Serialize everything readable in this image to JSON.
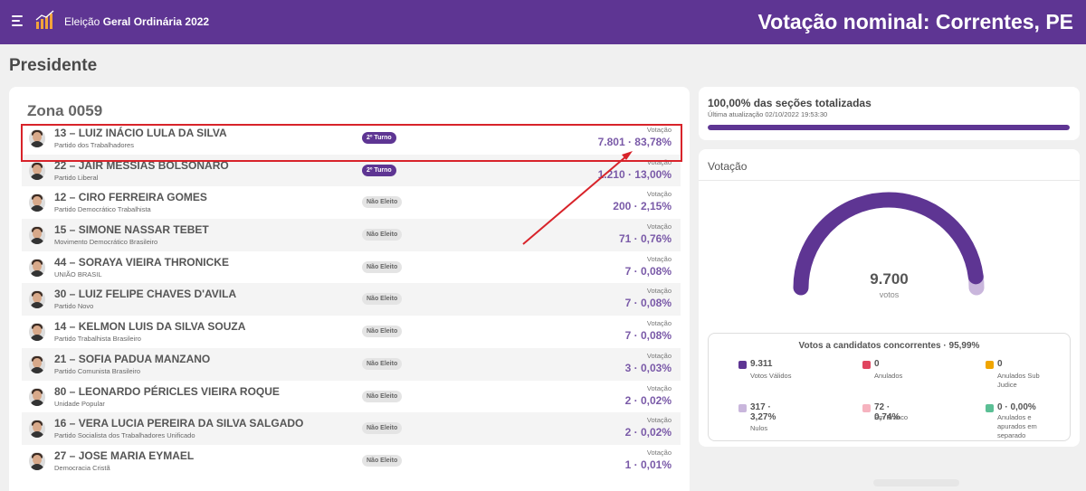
{
  "header": {
    "menu_icon": "hamburger-icon",
    "logo_icon": "bar-chart-icon",
    "app_title_prefix": "Eleição",
    "app_title_bold": "Geral Ordinária 2022",
    "page_title": "Votação nominal: Correntes, PE",
    "color": "#5e3593"
  },
  "section": {
    "title": "Presidente"
  },
  "zona": {
    "title": "Zona 0059"
  },
  "candidates": [
    {
      "name": "13 – LUIZ INÁCIO LULA DA SILVA",
      "party": "Partido dos Trabalhadores",
      "status": "2º Turno",
      "vote_label": "Votação",
      "vote": "7.801 · 83,78%"
    },
    {
      "name": "22 – JAIR MESSIAS BOLSONARO",
      "party": "Partido Liberal",
      "status": "2º Turno",
      "vote_label": "Votação",
      "vote": "1.210 · 13,00%"
    },
    {
      "name": "12 – CIRO FERREIRA GOMES",
      "party": "Partido Democrático Trabalhista",
      "status": "Não Eleito",
      "vote_label": "Votação",
      "vote": "200 · 2,15%"
    },
    {
      "name": "15 – SIMONE NASSAR TEBET",
      "party": "Movimento Democrático Brasileiro",
      "status": "Não Eleito",
      "vote_label": "Votação",
      "vote": "71 · 0,76%"
    },
    {
      "name": "44 – SORAYA VIEIRA THRONICKE",
      "party": "UNIÃO BRASIL",
      "status": "Não Eleito",
      "vote_label": "Votação",
      "vote": "7 · 0,08%"
    },
    {
      "name": "30 – LUIZ FELIPE CHAVES D'AVILA",
      "party": "Partido Novo",
      "status": "Não Eleito",
      "vote_label": "Votação",
      "vote": "7 · 0,08%"
    },
    {
      "name": "14 – KELMON LUIS DA SILVA SOUZA",
      "party": "Partido Trabalhista Brasileiro",
      "status": "Não Eleito",
      "vote_label": "Votação",
      "vote": "7 · 0,08%"
    },
    {
      "name": "21 – SOFIA PADUA MANZANO",
      "party": "Partido Comunista Brasileiro",
      "status": "Não Eleito",
      "vote_label": "Votação",
      "vote": "3 · 0,03%"
    },
    {
      "name": "80 – LEONARDO PÉRICLES VIEIRA ROQUE",
      "party": "Unidade Popular",
      "status": "Não Eleito",
      "vote_label": "Votação",
      "vote": "2 · 0,02%"
    },
    {
      "name": "16 – VERA LUCIA PEREIRA DA SILVA SALGADO",
      "party": "Partido Socialista dos Trabalhadores Unificado",
      "status": "Não Eleito",
      "vote_label": "Votação",
      "vote": "2 · 0,02%"
    },
    {
      "name": "27 – JOSE MARIA EYMAEL",
      "party": "Democracia Cristã",
      "status": "Não Eleito",
      "vote_label": "Votação",
      "vote": "1 · 0,01%"
    }
  ],
  "status": {
    "title": "100,00% das seções totalizadas",
    "updated": "Última atualização 02/10/2022 19:53:30",
    "progress": 1.0
  },
  "votacao": {
    "title": "Votação",
    "total": "9.700",
    "total_label": "votos",
    "gauge_fraction_valid": 0.9599,
    "gauge_color_main": "#5e3593",
    "gauge_color_rest": "#c9b6dc",
    "legend_title": "Votos a candidatos concorrentes · 95,99%",
    "legend": [
      {
        "value": "9.311",
        "label": "Votos Válidos",
        "color": "#5e3593"
      },
      {
        "value": "0",
        "label": "Anulados",
        "color": "#e0455f"
      },
      {
        "value": "0",
        "label": "Anulados Sub Judice",
        "color": "#f0a500"
      },
      {
        "value": "317 · 3,27%",
        "label": "Nulos",
        "color": "#c9b6dc"
      },
      {
        "value": "72 · 0,74%",
        "label": "Em Branco",
        "color": "#f6b3bf"
      },
      {
        "value": "0 · 0,00%",
        "label": "Anulados e apurados em separado",
        "color": "#5bbf95"
      }
    ]
  }
}
